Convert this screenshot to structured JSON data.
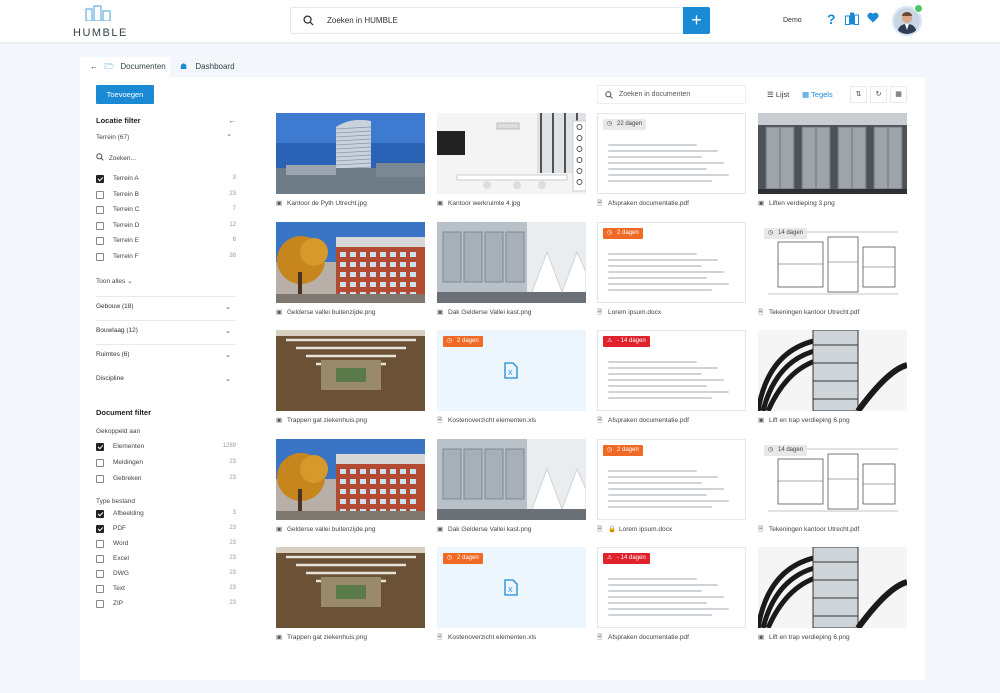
{
  "app": {
    "name": "HUMBLE",
    "search_placeholder": "Zoeken in HUMBLE",
    "add_label": "+",
    "demo_label": "Demo"
  },
  "tabs": [
    {
      "label": "Documenten"
    },
    {
      "label": "Dashboard"
    }
  ],
  "sidebar": {
    "add_button": "Toevoegen",
    "location_filter_title": "Locatie filter",
    "terrein_title": "Terrein (67)",
    "search_placeholder": "Zoeken...",
    "terreinen": [
      {
        "label": "Terrein A",
        "count": "3",
        "checked": true
      },
      {
        "label": "Terrein B",
        "count": "23",
        "checked": false
      },
      {
        "label": "Terrein C",
        "count": "7",
        "checked": false
      },
      {
        "label": "Terrein D",
        "count": "12",
        "checked": false
      },
      {
        "label": "Terrein E",
        "count": "6",
        "checked": false
      },
      {
        "label": "Terrein F",
        "count": "38",
        "checked": false
      }
    ],
    "show_all": "Toon alles",
    "accordions": [
      {
        "label": "Gebouw (18)"
      },
      {
        "label": "Bouwlaag (12)"
      },
      {
        "label": "Ruimtes (6)"
      },
      {
        "label": "Discipline"
      }
    ],
    "document_filter_title": "Document filter",
    "linked_title": "Gekoppeld aan",
    "linked": [
      {
        "label": "Elementen",
        "count": "1289",
        "checked": true
      },
      {
        "label": "Meldingen",
        "count": "23",
        "checked": false
      },
      {
        "label": "Gebreken",
        "count": "23",
        "checked": false
      }
    ],
    "type_title": "Type bestand",
    "types": [
      {
        "label": "Afbeelding",
        "count": "3",
        "checked": true
      },
      {
        "label": "PDF",
        "count": "23",
        "checked": true
      },
      {
        "label": "Word",
        "count": "23",
        "checked": false
      },
      {
        "label": "Excel",
        "count": "23",
        "checked": false
      },
      {
        "label": "DWG",
        "count": "23",
        "checked": false
      },
      {
        "label": "Text",
        "count": "23",
        "checked": false
      },
      {
        "label": "ZIP",
        "count": "23",
        "checked": false
      }
    ]
  },
  "toolbar": {
    "search_placeholder": "Zoeken in documenten",
    "view_list": "Lijst",
    "view_tiles": "Tegels"
  },
  "colors": {
    "accent": "#1a8ad4",
    "orange": "#f06a25",
    "red": "#e0222d"
  },
  "files": [
    {
      "name": "Kantoor de Pyth Utrecht.jpg",
      "kind": "image",
      "thumb": "tower",
      "badge": "",
      "badge_style": ""
    },
    {
      "name": "Kantoor werkruimte 4.jpg",
      "kind": "image",
      "thumb": "office",
      "badge": "",
      "badge_style": ""
    },
    {
      "name": "Afspraken documentatie.pdf",
      "kind": "pdf",
      "thumb": "doc",
      "badge": "22 dagen",
      "badge_style": "grey"
    },
    {
      "name": "Liften verdieping 3.png",
      "kind": "image",
      "thumb": "elevator",
      "badge": "",
      "badge_style": ""
    },
    {
      "name": "Gelderse vallei buitenzijde.png",
      "kind": "image",
      "thumb": "hospital",
      "badge": "",
      "badge_style": ""
    },
    {
      "name": "Dak Gelderse Vallei kast.png",
      "kind": "image",
      "thumb": "hvac",
      "badge": "",
      "badge_style": ""
    },
    {
      "name": "Lorem ipsum.docx",
      "kind": "word",
      "thumb": "doc",
      "badge": "2 dagen",
      "badge_style": "orange"
    },
    {
      "name": "Tekeningen kantoor Utrecht.pdf",
      "kind": "pdf",
      "thumb": "plan",
      "badge": "14 dagen",
      "badge_style": "grey"
    },
    {
      "name": "Trappen gat ziekenhuis.png",
      "kind": "image",
      "thumb": "stairs",
      "badge": "",
      "badge_style": ""
    },
    {
      "name": "Kostenoverzicht elementen.xls",
      "kind": "excel",
      "thumb": "xls",
      "badge": "2 dagen",
      "badge_style": "orange"
    },
    {
      "name": "Afspraken documentatie.pdf",
      "kind": "pdf",
      "thumb": "doc",
      "badge": "- 14 dagen",
      "badge_style": "red"
    },
    {
      "name": "Lift en trap verdieping 6.png",
      "kind": "image",
      "thumb": "spiral",
      "badge": "",
      "badge_style": ""
    },
    {
      "name": "Gelderse vallei buitenzijde.png",
      "kind": "image",
      "thumb": "hospital",
      "badge": "",
      "badge_style": ""
    },
    {
      "name": "Dak Gelderse Vallei kast.png",
      "kind": "image",
      "thumb": "hvac",
      "badge": "",
      "badge_style": ""
    },
    {
      "name": "Lorem ipsum.docx",
      "kind": "word-locked",
      "thumb": "doc",
      "badge": "2 dagen",
      "badge_style": "orange"
    },
    {
      "name": "Tekeningen kantoor Utrecht.pdf",
      "kind": "pdf",
      "thumb": "plan",
      "badge": "14 dagen",
      "badge_style": "grey"
    },
    {
      "name": "Trappen gat ziekenhuis.png",
      "kind": "image",
      "thumb": "stairs",
      "badge": "",
      "badge_style": ""
    },
    {
      "name": "Kostenoverzicht elementen.xls",
      "kind": "excel",
      "thumb": "xls",
      "badge": "2 dagen",
      "badge_style": "orange"
    },
    {
      "name": "Afspraken documentatie.pdf",
      "kind": "pdf",
      "thumb": "doc",
      "badge": "- 14 dagen",
      "badge_style": "red"
    },
    {
      "name": "Lift en trap verdieping 6.png",
      "kind": "image",
      "thumb": "spiral",
      "badge": "",
      "badge_style": ""
    }
  ]
}
